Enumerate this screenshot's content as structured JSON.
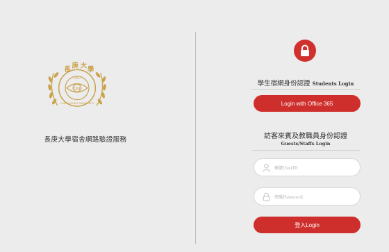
{
  "left": {
    "service_name": "長庚大學宿舍網路驗證服務",
    "logo_icon": "chang-gung-university-seal",
    "logo_text": [
      "長",
      "庚",
      "大",
      "學",
      "CHANG GUNG UNIVERSITY",
      "1987",
      "CGU"
    ]
  },
  "students": {
    "icon": "lock-icon",
    "title": "學生宿網身份認證",
    "title_en": "Students Login",
    "button_label": "Login with Office 365"
  },
  "guests": {
    "title": "訪客來賓及教職員身份認證",
    "subtitle": "Guests/Staffs Login",
    "username_placeholder": "帳號UserID",
    "password_placeholder": "密碼Password",
    "login_label": "登入Login"
  },
  "colors": {
    "accent": "#cf2f2c",
    "background": "#ececec",
    "logo_gold": "#c9a24a"
  }
}
